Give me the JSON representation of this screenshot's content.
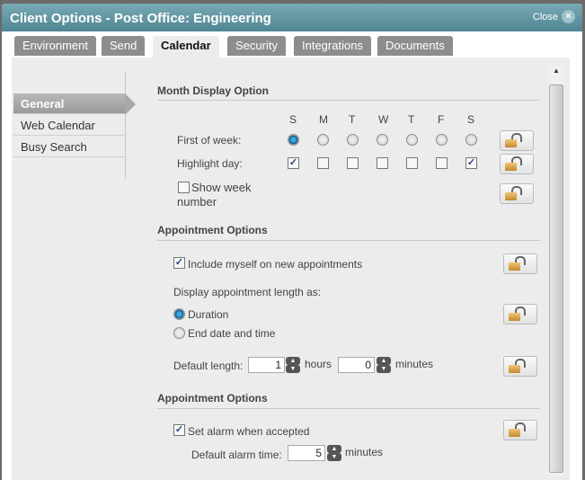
{
  "dialog": {
    "title": "Client Options - Post Office: Engineering",
    "close": "Close"
  },
  "tabs": [
    "Environment",
    "Send",
    "Calendar",
    "Security",
    "Integrations",
    "Documents"
  ],
  "nav": [
    "General",
    "Web Calendar",
    "Busy Search"
  ],
  "month": {
    "heading": "Month Display Option",
    "days": [
      "S",
      "M",
      "T",
      "W",
      "T",
      "F",
      "S"
    ],
    "first_label": "First of week:",
    "first_selected": 0,
    "highlight_label": "Highlight day:",
    "highlight": [
      true,
      false,
      false,
      false,
      false,
      false,
      true
    ],
    "week_number_1": "Show week",
    "week_number_2": "number"
  },
  "appt": {
    "heading": "Appointment Options",
    "include": "Include myself on new appointments",
    "display_label": "Display appointment length as:",
    "duration": "Duration",
    "end": "End date and time",
    "default_label": "Default length:",
    "hours_value": "1",
    "hours": "hours",
    "minutes_value": "0",
    "minutes": "minutes"
  },
  "alarm": {
    "heading": "Appointment Options",
    "set": "Set alarm when accepted",
    "time_label": "Default alarm time:",
    "time_value": "5",
    "minutes": "minutes"
  }
}
